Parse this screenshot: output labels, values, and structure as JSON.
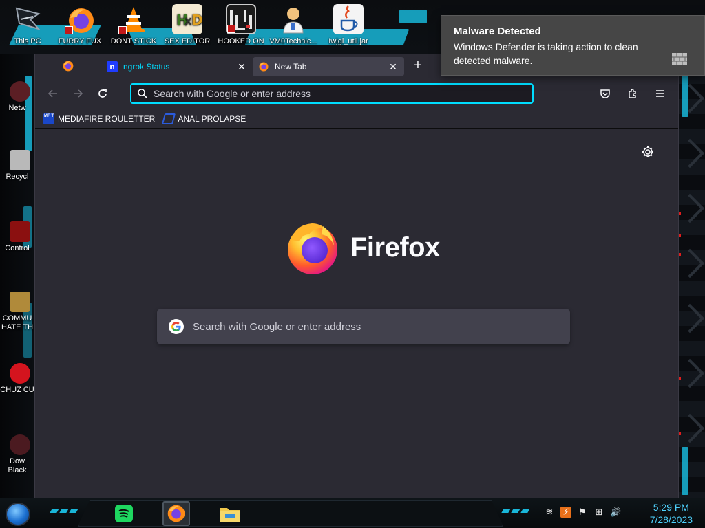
{
  "desktop": {
    "top_icons": [
      {
        "label": "This PC"
      },
      {
        "label": "FURRY FUX"
      },
      {
        "label": "DONT STICK"
      },
      {
        "label": "SEX EDITOR"
      },
      {
        "label": "HOOKED ON"
      },
      {
        "label": "VM0Technic..."
      },
      {
        "label": "Iwjgl_util.jar"
      }
    ],
    "left_icons": [
      {
        "label": "Netw"
      },
      {
        "label": "Recycl"
      },
      {
        "label": "Control"
      },
      {
        "label": "COMMU HATE TH"
      },
      {
        "label": "CHUZ CU"
      },
      {
        "label": "Dow Black"
      }
    ]
  },
  "notification": {
    "title": "Malware Detected",
    "body": "Windows Defender is taking action to clean detected malware."
  },
  "browser": {
    "tabs": [
      {
        "title": "ngrok Status",
        "favicon": "ngrok-icon",
        "active": false
      },
      {
        "title": "New Tab",
        "favicon": "firefox-icon",
        "active": true
      }
    ],
    "urlbar": {
      "placeholder": "Search with Google or enter address",
      "value": ""
    },
    "bookmarks": [
      {
        "label": "MEDIAFIRE ROULETTER",
        "icon": "mediafire-icon",
        "icon_text": "MF T"
      },
      {
        "label": "ANAL PROLAPSE",
        "icon": "bookmark-glyph-icon"
      }
    ],
    "newtab": {
      "brand": "Firefox",
      "search_placeholder": "Search with Google or enter address"
    },
    "accent_color": "#00ddff"
  },
  "taskbar": {
    "time": "5:29 PM",
    "date": "7/28/2023",
    "apps": [
      {
        "name": "spotify-icon",
        "active": false
      },
      {
        "name": "firefox-icon",
        "active": true
      },
      {
        "name": "file-explorer-icon",
        "active": false
      }
    ]
  }
}
